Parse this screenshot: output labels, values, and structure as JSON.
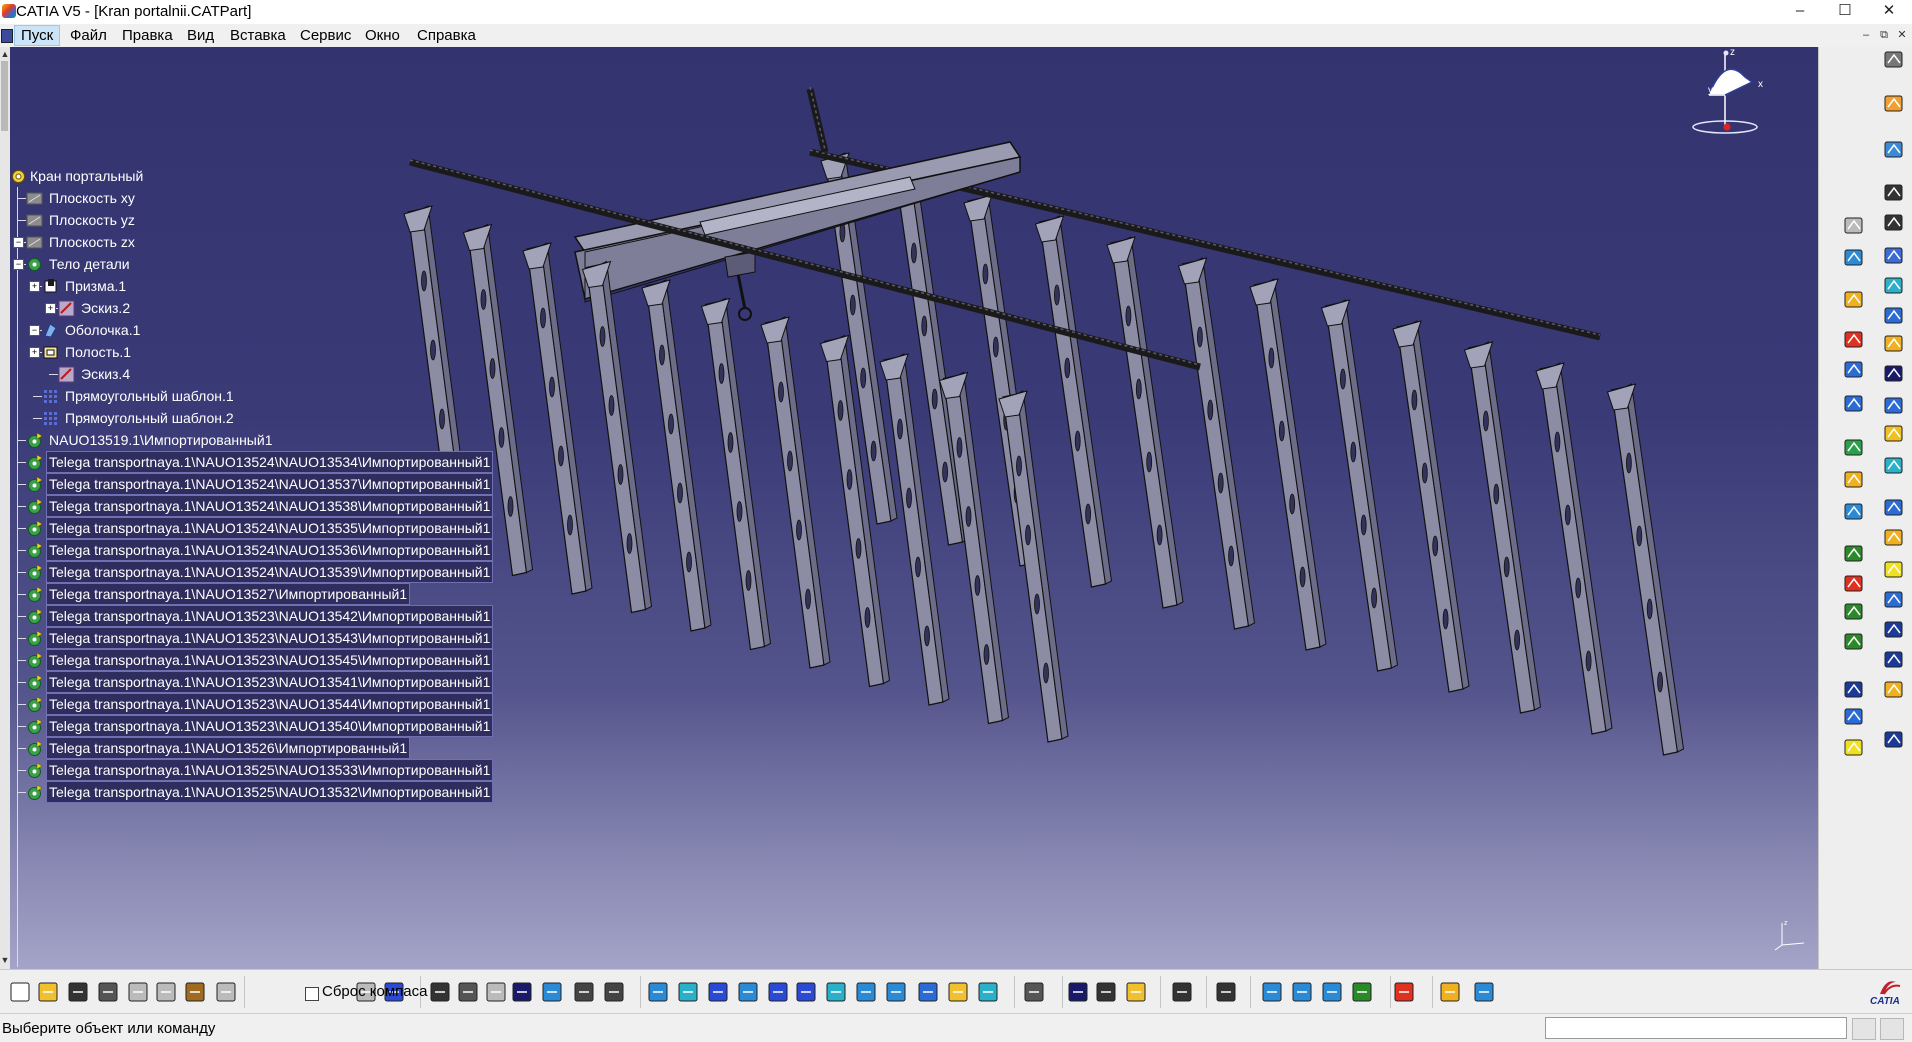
{
  "window": {
    "title": "CATIA V5 - [Kran portalnii.CATPart]",
    "controls": [
      "–",
      "☐",
      "✕"
    ],
    "mdi_controls": [
      "–",
      "⧉",
      "✕"
    ]
  },
  "menu": {
    "items": [
      "Пуск",
      "Файл",
      "Правка",
      "Вид",
      "Вставка",
      "Сервис",
      "Окно",
      "Справка"
    ]
  },
  "tree": {
    "root": "Кран портальный",
    "items": [
      {
        "label": "Плоскость xy",
        "icon": "plane-icon",
        "depth": 1,
        "selected": false
      },
      {
        "label": "Плоскость yz",
        "icon": "plane-icon",
        "depth": 1,
        "selected": false
      },
      {
        "label": "Плоскость zx",
        "icon": "plane-icon",
        "depth": 1,
        "selected": false
      },
      {
        "label": "Тело детали",
        "icon": "part-body-icon",
        "depth": 1,
        "selected": false
      },
      {
        "label": "Призма.1",
        "icon": "pad-icon",
        "depth": 2,
        "selected": false
      },
      {
        "label": "Эскиз.2",
        "icon": "sketch-icon",
        "depth": 3,
        "selected": false
      },
      {
        "label": "Оболочка.1",
        "icon": "shell-icon",
        "depth": 2,
        "selected": false
      },
      {
        "label": "Полость.1",
        "icon": "pocket-icon",
        "depth": 2,
        "selected": false
      },
      {
        "label": "Эскиз.4",
        "icon": "sketch-icon",
        "depth": 3,
        "selected": false
      },
      {
        "label": "Прямоугольный шаблон.1",
        "icon": "pattern-icon",
        "depth": 2,
        "selected": false
      },
      {
        "label": "Прямоугольный шаблон.2",
        "icon": "pattern-icon",
        "depth": 2,
        "selected": false
      },
      {
        "label": "NAUO13519.1\\Импортированный1",
        "icon": "imported-body-icon",
        "depth": 1,
        "selected": false
      },
      {
        "label": "Telega transportnaya.1\\NAUO13524\\NAUO13534\\Импортированный1",
        "icon": "imported-body-icon",
        "depth": 1,
        "selected": true
      },
      {
        "label": "Telega transportnaya.1\\NAUO13524\\NAUO13537\\Импортированный1",
        "icon": "imported-body-icon",
        "depth": 1,
        "selected": true
      },
      {
        "label": "Telega transportnaya.1\\NAUO13524\\NAUO13538\\Импортированный1",
        "icon": "imported-body-icon",
        "depth": 1,
        "selected": true
      },
      {
        "label": "Telega transportnaya.1\\NAUO13524\\NAUO13535\\Импортированный1",
        "icon": "imported-body-icon",
        "depth": 1,
        "selected": true
      },
      {
        "label": "Telega transportnaya.1\\NAUO13524\\NAUO13536\\Импортированный1",
        "icon": "imported-body-icon",
        "depth": 1,
        "selected": true
      },
      {
        "label": "Telega transportnaya.1\\NAUO13524\\NAUO13539\\Импортированный1",
        "icon": "imported-body-icon",
        "depth": 1,
        "selected": true
      },
      {
        "label": "Telega transportnaya.1\\NAUO13527\\Импортированный1",
        "icon": "imported-body-icon",
        "depth": 1,
        "selected": true
      },
      {
        "label": "Telega transportnaya.1\\NAUO13523\\NAUO13542\\Импортированный1",
        "icon": "imported-body-icon",
        "depth": 1,
        "selected": true
      },
      {
        "label": "Telega transportnaya.1\\NAUO13523\\NAUO13543\\Импортированный1",
        "icon": "imported-body-icon",
        "depth": 1,
        "selected": true
      },
      {
        "label": "Telega transportnaya.1\\NAUO13523\\NAUO13545\\Импортированный1",
        "icon": "imported-body-icon",
        "depth": 1,
        "selected": true
      },
      {
        "label": "Telega transportnaya.1\\NAUO13523\\NAUO13541\\Импортированный1",
        "icon": "imported-body-icon",
        "depth": 1,
        "selected": true
      },
      {
        "label": "Telega transportnaya.1\\NAUO13523\\NAUO13544\\Импортированный1",
        "icon": "imported-body-icon",
        "depth": 1,
        "selected": true
      },
      {
        "label": "Telega transportnaya.1\\NAUO13523\\NAUO13540\\Импортированный1",
        "icon": "imported-body-icon",
        "depth": 1,
        "selected": true
      },
      {
        "label": "Telega transportnaya.1\\NAUO13526\\Импортированный1",
        "icon": "imported-body-icon",
        "depth": 1,
        "selected": true
      },
      {
        "label": "Telega transportnaya.1\\NAUO13525\\NAUO13533\\Импортированный1",
        "icon": "imported-body-icon",
        "depth": 1,
        "selected": true
      },
      {
        "label": "Telega transportnaya.1\\NAUO13525\\NAUO13532\\Импортированный1",
        "icon": "imported-body-icon",
        "depth": 1,
        "selected": true
      }
    ]
  },
  "compass": {
    "x": "x",
    "y": "y",
    "z": "z"
  },
  "toolbar": {
    "compass_reset_label": "Сброс компаса",
    "compass_reset_checked": false
  },
  "status": {
    "text": "Выберите объект или команду",
    "command_value": ""
  },
  "brand": {
    "logo_text": "CATIA"
  },
  "colors": {
    "viewport_top": "#33336f",
    "viewport_bottom": "#a4a4c8",
    "selection": "#2e2d5e",
    "model_fill": "#8c8ca4",
    "model_edge": "#111111"
  }
}
